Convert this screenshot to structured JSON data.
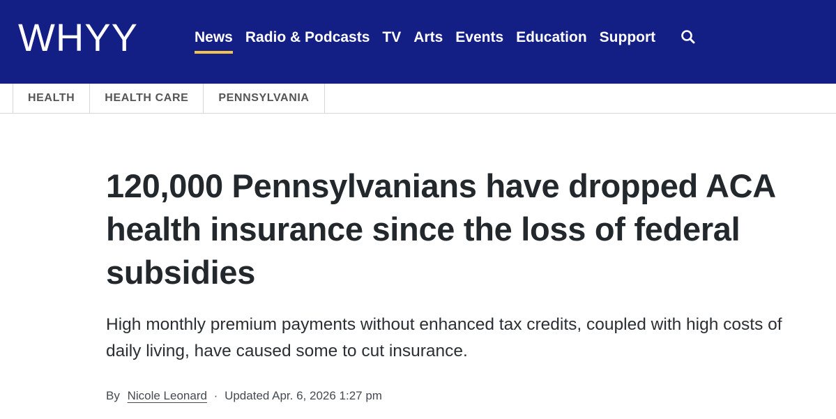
{
  "header": {
    "logo": "WHYY",
    "nav": [
      {
        "label": "News",
        "active": true
      },
      {
        "label": "Radio & Podcasts",
        "active": false
      },
      {
        "label": "TV",
        "active": false
      },
      {
        "label": "Arts",
        "active": false
      },
      {
        "label": "Events",
        "active": false
      },
      {
        "label": "Education",
        "active": false
      },
      {
        "label": "Support",
        "active": false
      }
    ],
    "search_icon": "search-icon"
  },
  "tags": [
    "HEALTH",
    "HEALTH CARE",
    "PENNSYLVANIA"
  ],
  "article": {
    "headline": "120,000 Pennsylvanians have dropped ACA health insurance since the loss of federal subsidies",
    "dek": "High monthly premium payments without enhanced tax credits, coupled with high costs of daily living, have caused some to cut insurance.",
    "byline_prefix": "By",
    "author": "Nicole Leonard",
    "separator": "·",
    "updated": "Updated Apr. 6, 2026 1:27 pm"
  },
  "colors": {
    "header_bg": "#141f86",
    "nav_active_underline": "#f3c24c",
    "headline_text": "#23282d"
  }
}
